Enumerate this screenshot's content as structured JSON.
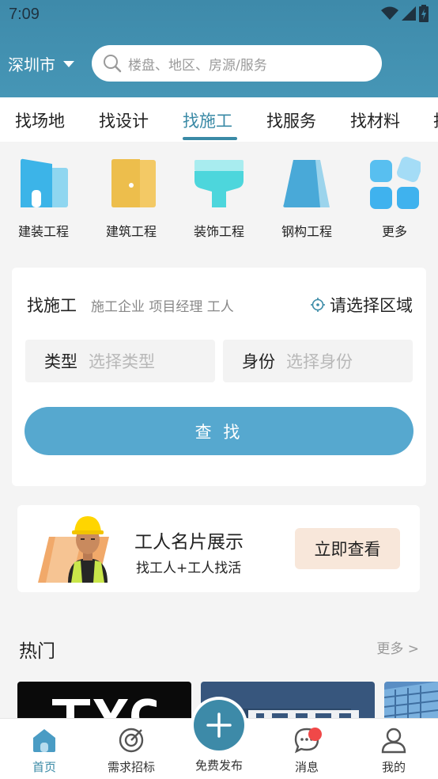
{
  "status_bar": {
    "time": "7:09"
  },
  "header": {
    "city": "深圳市",
    "search_placeholder": "楼盘、地区、房源/服务"
  },
  "tabs": [
    {
      "label": "找场地"
    },
    {
      "label": "找设计"
    },
    {
      "label": "找施工",
      "active": true
    },
    {
      "label": "找服务"
    },
    {
      "label": "找材料"
    }
  ],
  "categories": [
    {
      "label": "建装工程",
      "icon": "building-icon"
    },
    {
      "label": "建筑工程",
      "icon": "door-icon"
    },
    {
      "label": "装饰工程",
      "icon": "paint-roller-icon"
    },
    {
      "label": "钢构工程",
      "icon": "steel-structure-icon"
    },
    {
      "label": "更多",
      "icon": "grid-more-icon"
    }
  ],
  "finder": {
    "title": "找施工",
    "subtitle": "施工企业 项目经理 工人",
    "area_label": "请选择区域",
    "type_label": "类型",
    "type_placeholder": "选择类型",
    "identity_label": "身份",
    "identity_placeholder": "选择身份",
    "search_button": "查 找"
  },
  "banner": {
    "title": "工人名片展示",
    "subtitle": "找工人+工人找活",
    "button": "立即查看"
  },
  "hot": {
    "title": "热门",
    "more": "更多 >"
  },
  "bottom_nav": [
    {
      "label": "首页",
      "icon": "home-icon",
      "active": true
    },
    {
      "label": "需求招标",
      "icon": "target-icon"
    },
    {
      "label": "免费发布",
      "icon": "plus-icon"
    },
    {
      "label": "消息",
      "icon": "chat-icon",
      "badge": true
    },
    {
      "label": "我的",
      "icon": "user-icon"
    }
  ],
  "colors": {
    "primary": "#3e8aaa",
    "button": "#56a8cf",
    "accent_tab": "#3a8aa6",
    "badge": "#f04848"
  }
}
